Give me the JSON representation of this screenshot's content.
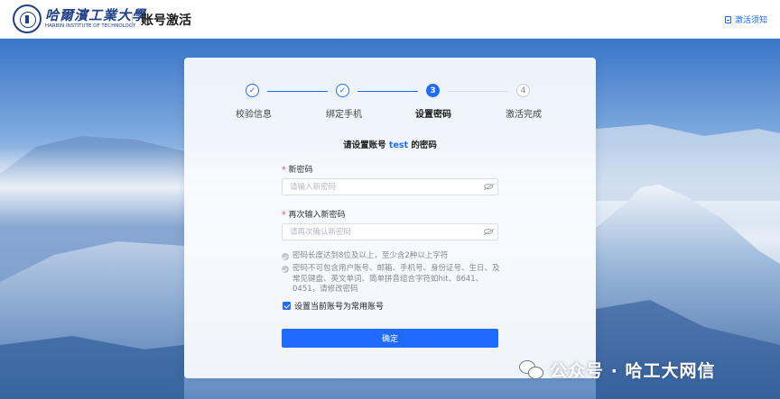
{
  "header": {
    "logo_cn": "哈爾濱工業大學",
    "logo_en": "HARBIN INSTITUTE OF TECHNOLOGY",
    "page_title": "账号激活",
    "notice_label": "激活须知"
  },
  "steps": [
    {
      "label": "校验信息",
      "state": "done",
      "symbol": "✓"
    },
    {
      "label": "绑定手机",
      "state": "done",
      "symbol": "✓"
    },
    {
      "label": "设置密码",
      "state": "active",
      "symbol": "3"
    },
    {
      "label": "激活完成",
      "state": "pending",
      "symbol": "4"
    }
  ],
  "form": {
    "prompt_prefix": "请设置账号",
    "username": "test",
    "prompt_suffix": "的密码",
    "required_mark": "*",
    "new_password_label": "新密码",
    "new_password_placeholder": "请输入新密码",
    "confirm_password_label": "再次输入新密码",
    "confirm_password_placeholder": "请再次确认新密码",
    "rules": [
      "密码长度达到8位及以上，至少含2种以上字符",
      "密码不可包含用户账号、邮箱、手机号、身份证号、生日、及常见键盘、英文单词、简单拼音组合字符如hit、8641、0451，请修改密码"
    ],
    "common_account_label": "设置当前账号为常用账号",
    "common_account_checked": true,
    "confirm_label": "确定"
  },
  "watermark": {
    "text": "公众号 · 哈工大网信"
  },
  "colors": {
    "primary": "#1f6bff",
    "required": "#e24c4c"
  }
}
